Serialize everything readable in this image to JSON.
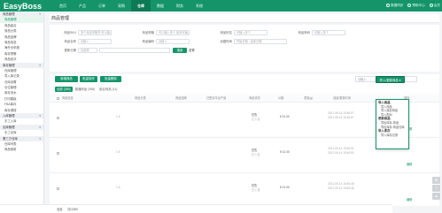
{
  "app": {
    "brand": "EasyBoss"
  },
  "topnav": [
    "首页",
    "产品",
    "订单",
    "采购",
    "仓库",
    "数据",
    "财务",
    "系统"
  ],
  "topnav_active": "仓库",
  "topright": [
    "数据同步",
    "帮助中心",
    "会员"
  ],
  "sidebar": [
    {
      "label": "商品管理",
      "group": true
    },
    {
      "label": "商品管理",
      "active": true
    },
    {
      "label": "商品组合"
    },
    {
      "label": "商品分类"
    },
    {
      "label": "商品品牌"
    },
    {
      "label": "商品信息"
    },
    {
      "label": "海外仓申报"
    },
    {
      "label": "库存预警"
    },
    {
      "label": "商品批次"
    },
    {
      "label": "库存管理",
      "group": true
    },
    {
      "label": "仓库管理"
    },
    {
      "label": "导入库记录"
    },
    {
      "label": "仓库设置"
    },
    {
      "label": "仓位管理"
    },
    {
      "label": "库存流水"
    },
    {
      "label": "打印模板"
    },
    {
      "label": "FBA库存"
    },
    {
      "label": "库存调拨"
    },
    {
      "label": "入库管理",
      "group": true
    },
    {
      "label": "手工入库"
    },
    {
      "label": "出库管理",
      "group": true
    },
    {
      "label": "手工出库"
    },
    {
      "label": "第三方仓库",
      "group": true
    },
    {
      "label": "仓库列表"
    },
    {
      "label": "商品映射"
    }
  ],
  "page_title": "商品管理",
  "filters": {
    "row1": [
      {
        "label": "商品SKU",
        "placeholder": "多个用逗号隔开,可以输入多个"
      },
      {
        "label": "商品规格",
        "placeholder": "可以输入多个,最多可输入多个"
      },
      {
        "label": "商品别名",
        "placeholder": "可输入多个"
      },
      {
        "label": "商品条码",
        "placeholder": "可输入多个"
      }
    ],
    "row2": [
      {
        "label": "商品名称",
        "placeholder": "请输入"
      },
      {
        "label": "商品编码",
        "placeholder": "请输入"
      },
      {
        "label": "创建时间",
        "placeholder": "开始日期  -  结束日期"
      }
    ],
    "row3_label": "更新日期",
    "row3_placeholder": "请选择",
    "search_label": "搜索",
    "reset_label": "重置"
  },
  "toolbar": {
    "buttons": [
      "新增商品",
      "批量操作",
      "批量删除"
    ],
    "tabs": [
      "全部 (369)",
      "普通商品 (358)",
      "组合商品 (11)"
    ],
    "search_placeholder": "请输入",
    "import_label": "导入/更新商品"
  },
  "dropdown": [
    {
      "label": "导入商品",
      "group": true
    },
    {
      "label": "导入商品"
    },
    {
      "label": "导入组合商品"
    },
    {
      "label": "导入配对"
    },
    {
      "label": "更新商品",
      "group": true
    },
    {
      "label": "导出库存-商品"
    },
    {
      "label": "导出库存-商品仓库"
    },
    {
      "label": "导入库存",
      "group": true
    },
    {
      "label": "导入库存记录"
    }
  ],
  "table": {
    "headers": [
      "商品信息",
      "商品分类",
      "商品品牌",
      "已配对平台产品",
      "商品状态",
      "价格",
      "重量(g)",
      "创建/更新时间",
      "操作"
    ],
    "rows": [
      {
        "sku": "1 A",
        "status": "在售",
        "sub": "已入仓",
        "price": "¥ 21.00",
        "created": "2021-09-14 15:46:57",
        "updated": "2021-09-14 15:46:57",
        "action": "编辑"
      },
      {
        "sku": "1 8",
        "status": "在售",
        "sub": "已入仓",
        "price": "¥ 21.00",
        "created": "2021-09-14 15:46:51",
        "updated": "2021-09-14 15:46:51",
        "action": "编辑"
      },
      {
        "sku": "1 A",
        "status": "在售",
        "sub": "已入仓",
        "price": "¥ 21.00",
        "created": "2021-09-14 15:46:48",
        "updated": "2021-09-14 15:46:48",
        "action": "编辑"
      }
    ]
  },
  "footer": {
    "select_all": "全选",
    "summary": "共计369"
  }
}
